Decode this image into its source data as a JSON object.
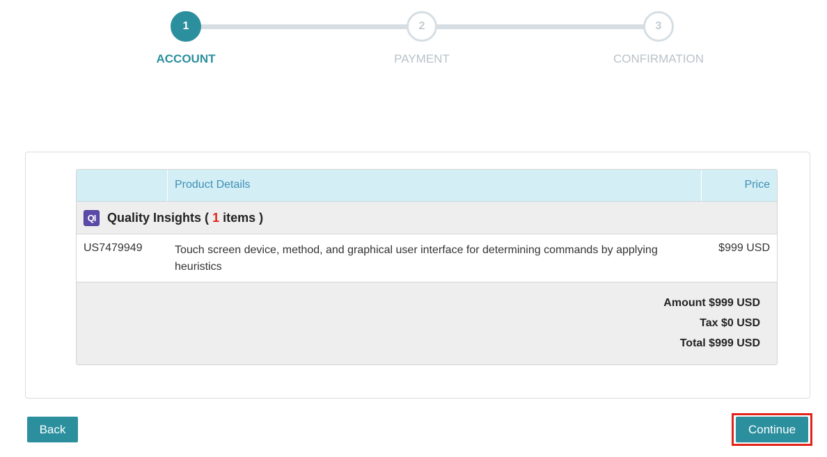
{
  "stepper": {
    "steps": [
      {
        "number": "1",
        "label": "ACCOUNT",
        "state": "active"
      },
      {
        "number": "2",
        "label": "PAYMENT",
        "state": "inactive"
      },
      {
        "number": "3",
        "label": "CONFIRMATION",
        "state": "inactive"
      }
    ]
  },
  "order": {
    "headers": {
      "details": "Product Details",
      "price": "Price"
    },
    "group": {
      "icon_text": "QI",
      "name": "Quality Insights",
      "open": "(",
      "count": "1",
      "count_suffix": "items",
      "close": ")"
    },
    "items": [
      {
        "id": "US7479949",
        "description": "Touch screen device, method, and graphical user interface for determining commands by applying heuristics",
        "price": "$999 USD"
      }
    ],
    "totals": {
      "amount": "Amount $999 USD",
      "tax": "Tax $0 USD",
      "total": "Total $999 USD"
    }
  },
  "actions": {
    "back_label": "Back",
    "continue_label": "Continue"
  },
  "colors": {
    "accent": "#2b8f9e",
    "header_bg": "#d3eef5",
    "highlight": "#e2231a",
    "qi_icon": "#5b4aa8"
  }
}
